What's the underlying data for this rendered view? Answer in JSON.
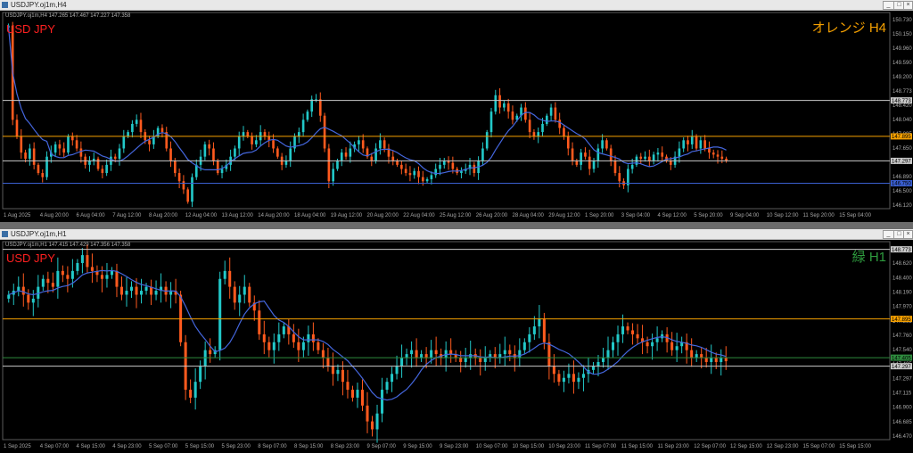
{
  "windows": [
    {
      "title": "USDJPY.oj1m,H4",
      "chart_data": {
        "type": "candlestick",
        "info_line": "USDJPY.oj1m,H4  147.265 147.467 147.227 147.358",
        "symbol_label": "USD JPY",
        "corner_label": "オレンジ H4",
        "ylim": [
          146.13,
          150.92
        ],
        "y_ticks": [
          "150.730",
          "150.150",
          "149.960",
          "149.590",
          "149.200",
          "148.773",
          "148.420",
          "148.040",
          "147.895",
          "147.650",
          "147.297",
          "146.890",
          "146.500",
          "146.120"
        ],
        "x_ticks": [
          "1 Aug 2025",
          "4 Aug 20:00",
          "6 Aug 04:00",
          "7 Aug 12:00",
          "8 Aug 20:00",
          "12 Aug 04:00",
          "13 Aug 12:00",
          "14 Aug 20:00",
          "18 Aug 04:00",
          "19 Aug 12:00",
          "20 Aug 20:00",
          "22 Aug 04:00",
          "25 Aug 12:00",
          "26 Aug 20:00",
          "28 Aug 04:00",
          "29 Aug 12:00",
          "1 Sep 20:00",
          "3 Sep 04:00",
          "4 Sep 12:00",
          "5 Sep 20:00",
          "9 Sep 04:00",
          "10 Sep 12:00",
          "11 Sep 20:00",
          "15 Sep 04:00"
        ],
        "levels": [
          {
            "value": 148.773,
            "label": "148.773",
            "color": "#c8c8c8"
          },
          {
            "value": 147.895,
            "label": "147.895",
            "color": "#f5a000"
          },
          {
            "value": 147.297,
            "label": "147.297",
            "color": "#c8c8c8"
          },
          {
            "value": 146.75,
            "label": "146.750",
            "color": "#3a5fd0"
          }
        ],
        "ma_color": "#4466dd",
        "up_color": "#22c8c8",
        "down_color": "#ff5a1e",
        "closes": [
          150.6,
          148.3,
          147.9,
          147.5,
          147.35,
          147.6,
          147.2,
          147.0,
          146.9,
          147.4,
          147.5,
          147.7,
          147.6,
          147.5,
          147.9,
          147.8,
          147.6,
          147.4,
          147.2,
          147.3,
          147.35,
          147.1,
          147.0,
          147.2,
          147.4,
          147.35,
          147.6,
          147.9,
          148.0,
          148.2,
          148.3,
          148.0,
          147.8,
          147.7,
          147.9,
          148.1,
          148.0,
          147.6,
          147.3,
          147.0,
          146.8,
          146.6,
          146.3,
          146.9,
          147.2,
          147.4,
          147.7,
          147.6,
          147.3,
          147.0,
          147.1,
          147.2,
          147.4,
          147.6,
          147.9,
          148.0,
          147.9,
          147.7,
          147.8,
          148.0,
          147.9,
          147.8,
          147.6,
          147.4,
          147.2,
          147.3,
          147.6,
          147.9,
          148.0,
          148.3,
          148.5,
          148.8,
          148.8,
          148.4,
          147.6,
          146.8,
          147.1,
          147.3,
          147.5,
          147.4,
          147.6,
          147.7,
          147.8,
          147.6,
          147.4,
          147.3,
          147.6,
          147.8,
          147.6,
          147.4,
          147.3,
          147.2,
          147.1,
          147.0,
          146.95,
          147.05,
          146.9,
          146.8,
          146.85,
          146.95,
          147.1,
          147.2,
          147.3,
          147.25,
          147.1,
          147.0,
          147.05,
          147.1,
          147.2,
          147.0,
          147.3,
          147.6,
          148.0,
          148.5,
          148.9,
          148.6,
          148.7,
          148.5,
          148.3,
          148.4,
          148.6,
          148.3,
          148.0,
          147.9,
          148.0,
          148.2,
          148.4,
          148.6,
          148.3,
          148.1,
          147.9,
          147.6,
          147.3,
          147.2,
          147.5,
          147.4,
          147.1,
          147.3,
          147.6,
          147.8,
          147.6,
          147.3,
          147.0,
          146.8,
          146.7,
          147.1,
          147.2,
          147.4,
          147.35,
          147.4,
          147.3,
          147.45,
          147.5,
          147.4,
          147.3,
          147.2,
          147.4,
          147.6,
          147.8,
          147.7,
          147.9,
          147.6,
          147.8,
          147.6,
          147.5,
          147.45,
          147.4,
          147.35,
          147.3
        ]
      }
    },
    {
      "title": "USDJPY.oj1m,H1",
      "chart_data": {
        "type": "candlestick",
        "info_line": "USDJPY.oj1m,H1  147.415 147.429 147.356 147.358",
        "symbol_label": "USD JPY",
        "corner_label": "緑 H1",
        "ylim": [
          146.37,
          148.87
        ],
        "y_ticks": [
          "148.773",
          "148.620",
          "148.400",
          "148.190",
          "147.970",
          "147.895",
          "147.760",
          "147.540",
          "147.405",
          "147.297",
          "147.115",
          "146.900",
          "146.685",
          "146.470"
        ],
        "x_ticks": [
          "1 Sep 2025",
          "4 Sep 07:00",
          "4 Sep 15:00",
          "4 Sep 23:00",
          "5 Sep 07:00",
          "5 Sep 15:00",
          "5 Sep 23:00",
          "8 Sep 07:00",
          "8 Sep 15:00",
          "8 Sep 23:00",
          "9 Sep 07:00",
          "9 Sep 15:00",
          "9 Sep 23:00",
          "10 Sep 07:00",
          "10 Sep 15:00",
          "10 Sep 23:00",
          "11 Sep 07:00",
          "11 Sep 15:00",
          "11 Sep 23:00",
          "12 Sep 07:00",
          "12 Sep 15:00",
          "12 Sep 23:00",
          "15 Sep 07:00",
          "15 Sep 15:00"
        ],
        "levels": [
          {
            "value": 148.773,
            "label": "148.773",
            "color": "#c8c8c8"
          },
          {
            "value": 147.895,
            "label": "147.895",
            "color": "#f5a000"
          },
          {
            "value": 147.405,
            "label": "147.405",
            "color": "#2e8b3e"
          },
          {
            "value": 147.297,
            "label": "147.297",
            "color": "#c8c8c8"
          }
        ],
        "ma_color": "#4466dd",
        "up_color": "#22c8c8",
        "down_color": "#ff5a1e",
        "closes": [
          148.2,
          148.25,
          148.3,
          148.2,
          148.1,
          148.15,
          148.3,
          148.4,
          148.35,
          148.3,
          148.5,
          148.45,
          148.4,
          148.5,
          148.6,
          148.7,
          148.55,
          148.5,
          148.45,
          148.4,
          148.45,
          148.5,
          148.3,
          148.2,
          148.25,
          148.3,
          148.2,
          148.25,
          148.3,
          148.2,
          148.25,
          148.3,
          148.2,
          148.25,
          148.2,
          147.6,
          147.0,
          146.9,
          147.1,
          147.3,
          147.5,
          147.45,
          147.5,
          148.4,
          148.5,
          148.3,
          148.1,
          148.2,
          148.3,
          148.1,
          148.0,
          147.7,
          147.6,
          147.5,
          147.6,
          147.7,
          147.8,
          147.7,
          147.6,
          147.5,
          147.6,
          147.7,
          147.6,
          147.5,
          147.4,
          147.3,
          147.2,
          147.25,
          147.1,
          147.0,
          146.9,
          147.0,
          146.8,
          146.6,
          146.5,
          146.7,
          147.0,
          147.1,
          147.2,
          147.3,
          147.4,
          147.45,
          147.5,
          147.4,
          147.45,
          147.4,
          147.5,
          147.45,
          147.4,
          147.5,
          147.45,
          147.4,
          147.35,
          147.4,
          147.45,
          147.4,
          147.35,
          147.4,
          147.45,
          147.4,
          147.45,
          147.5,
          147.45,
          147.4,
          147.5,
          147.6,
          147.7,
          147.8,
          147.9,
          147.6,
          147.3,
          147.2,
          147.1,
          147.15,
          147.2,
          147.1,
          147.15,
          147.2,
          147.25,
          147.3,
          147.35,
          147.4,
          147.5,
          147.6,
          147.7,
          147.8,
          147.75,
          147.7,
          147.65,
          147.6,
          147.55,
          147.6,
          147.65,
          147.7,
          147.6,
          147.5,
          147.55,
          147.6,
          147.5,
          147.4,
          147.45,
          147.4,
          147.35,
          147.4,
          147.35,
          147.4,
          147.36
        ]
      }
    }
  ]
}
